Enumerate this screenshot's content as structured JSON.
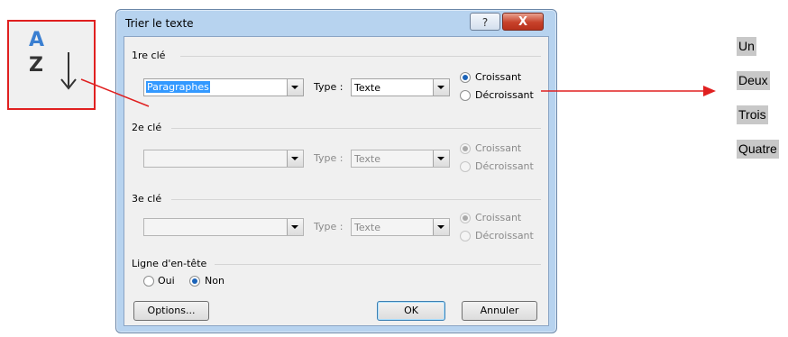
{
  "sort_icon": {
    "top_letter": "A",
    "bottom_letter": "Z",
    "icon": "sort-az-icon"
  },
  "dialog": {
    "title": "Trier le texte",
    "help_glyph": "?",
    "close_glyph": "X",
    "key1": {
      "label": "1re clé",
      "sort_by": "Paragraphes",
      "type_label": "Type :",
      "type_value": "Texte",
      "asc_label": "Croissant",
      "desc_label": "Décroissant"
    },
    "key2": {
      "label": "2e clé",
      "sort_by": "",
      "type_label": "Type :",
      "type_value": "Texte",
      "asc_label": "Croissant",
      "desc_label": "Décroissant"
    },
    "key3": {
      "label": "3e clé",
      "sort_by": "",
      "type_label": "Type :",
      "type_value": "Texte",
      "asc_label": "Croissant",
      "desc_label": "Décroissant"
    },
    "header_row": {
      "label": "Ligne d'en-tête",
      "yes_label": "Oui",
      "no_label": "Non",
      "selected": "Non"
    },
    "buttons": {
      "options": "Options...",
      "ok": "OK",
      "cancel": "Annuler"
    }
  },
  "sorted_words": [
    "Un",
    "Deux",
    "Trois",
    "Quatre"
  ],
  "colors": {
    "arrow": "#e02020",
    "dialog_frame": "#b7d3ef",
    "word_highlight": "#c8c8c8"
  }
}
